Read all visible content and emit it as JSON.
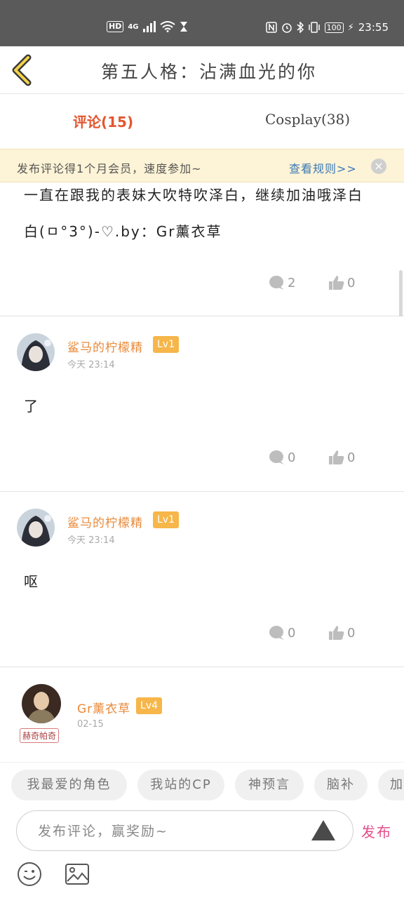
{
  "status_bar": {
    "network": "HD",
    "net_type": "4G",
    "battery": "100",
    "time": "23:55"
  },
  "header": {
    "title": "第五人格：沾满血光的你"
  },
  "tabs": [
    {
      "label": "评论(15)",
      "active": true
    },
    {
      "label": "Cosplay(38)",
      "active": false
    }
  ],
  "notice": {
    "text": "发布评论得1个月会员，速度参加~",
    "link": "查看规则>>",
    "close": "×"
  },
  "comments": [
    {
      "lines": [
        "一直在跟我的表妹大吹特吹泽白，继续加油哦泽白",
        "白(ㅁ°3°)-♡.by：Gr薰衣草"
      ],
      "replies": "2",
      "likes": "0"
    },
    {
      "user": "鲨马的柠檬精",
      "level": "Lv1",
      "time": "今天 23:14",
      "text": "了",
      "replies": "0",
      "likes": "0"
    },
    {
      "user": "鲨马的柠檬精",
      "level": "Lv1",
      "time": "今天 23:14",
      "text": "呕",
      "replies": "0",
      "likes": "0"
    },
    {
      "user": "Gr薰衣草",
      "level": "Lv4",
      "time": "02-15",
      "badge": "赫奇帕奇"
    }
  ],
  "chips": [
    "我最爱的角色",
    "我站的CP",
    "神预言",
    "脑补",
    "加"
  ],
  "input": {
    "placeholder": "发布评论，赢奖励~",
    "publish": "发布"
  },
  "colors": {
    "accent_red": "#e3562f",
    "username": "#e98a3a",
    "level_badge": "#f6b64a",
    "publish": "#e44b87",
    "notice_bg": "#fdf3d6",
    "link": "#3a7ab7"
  },
  "icons": [
    "back-chevron-icon",
    "comment-bubble-icon",
    "thumbs-up-icon",
    "emoji-icon",
    "image-icon",
    "send-triangle-icon",
    "close-icon"
  ]
}
